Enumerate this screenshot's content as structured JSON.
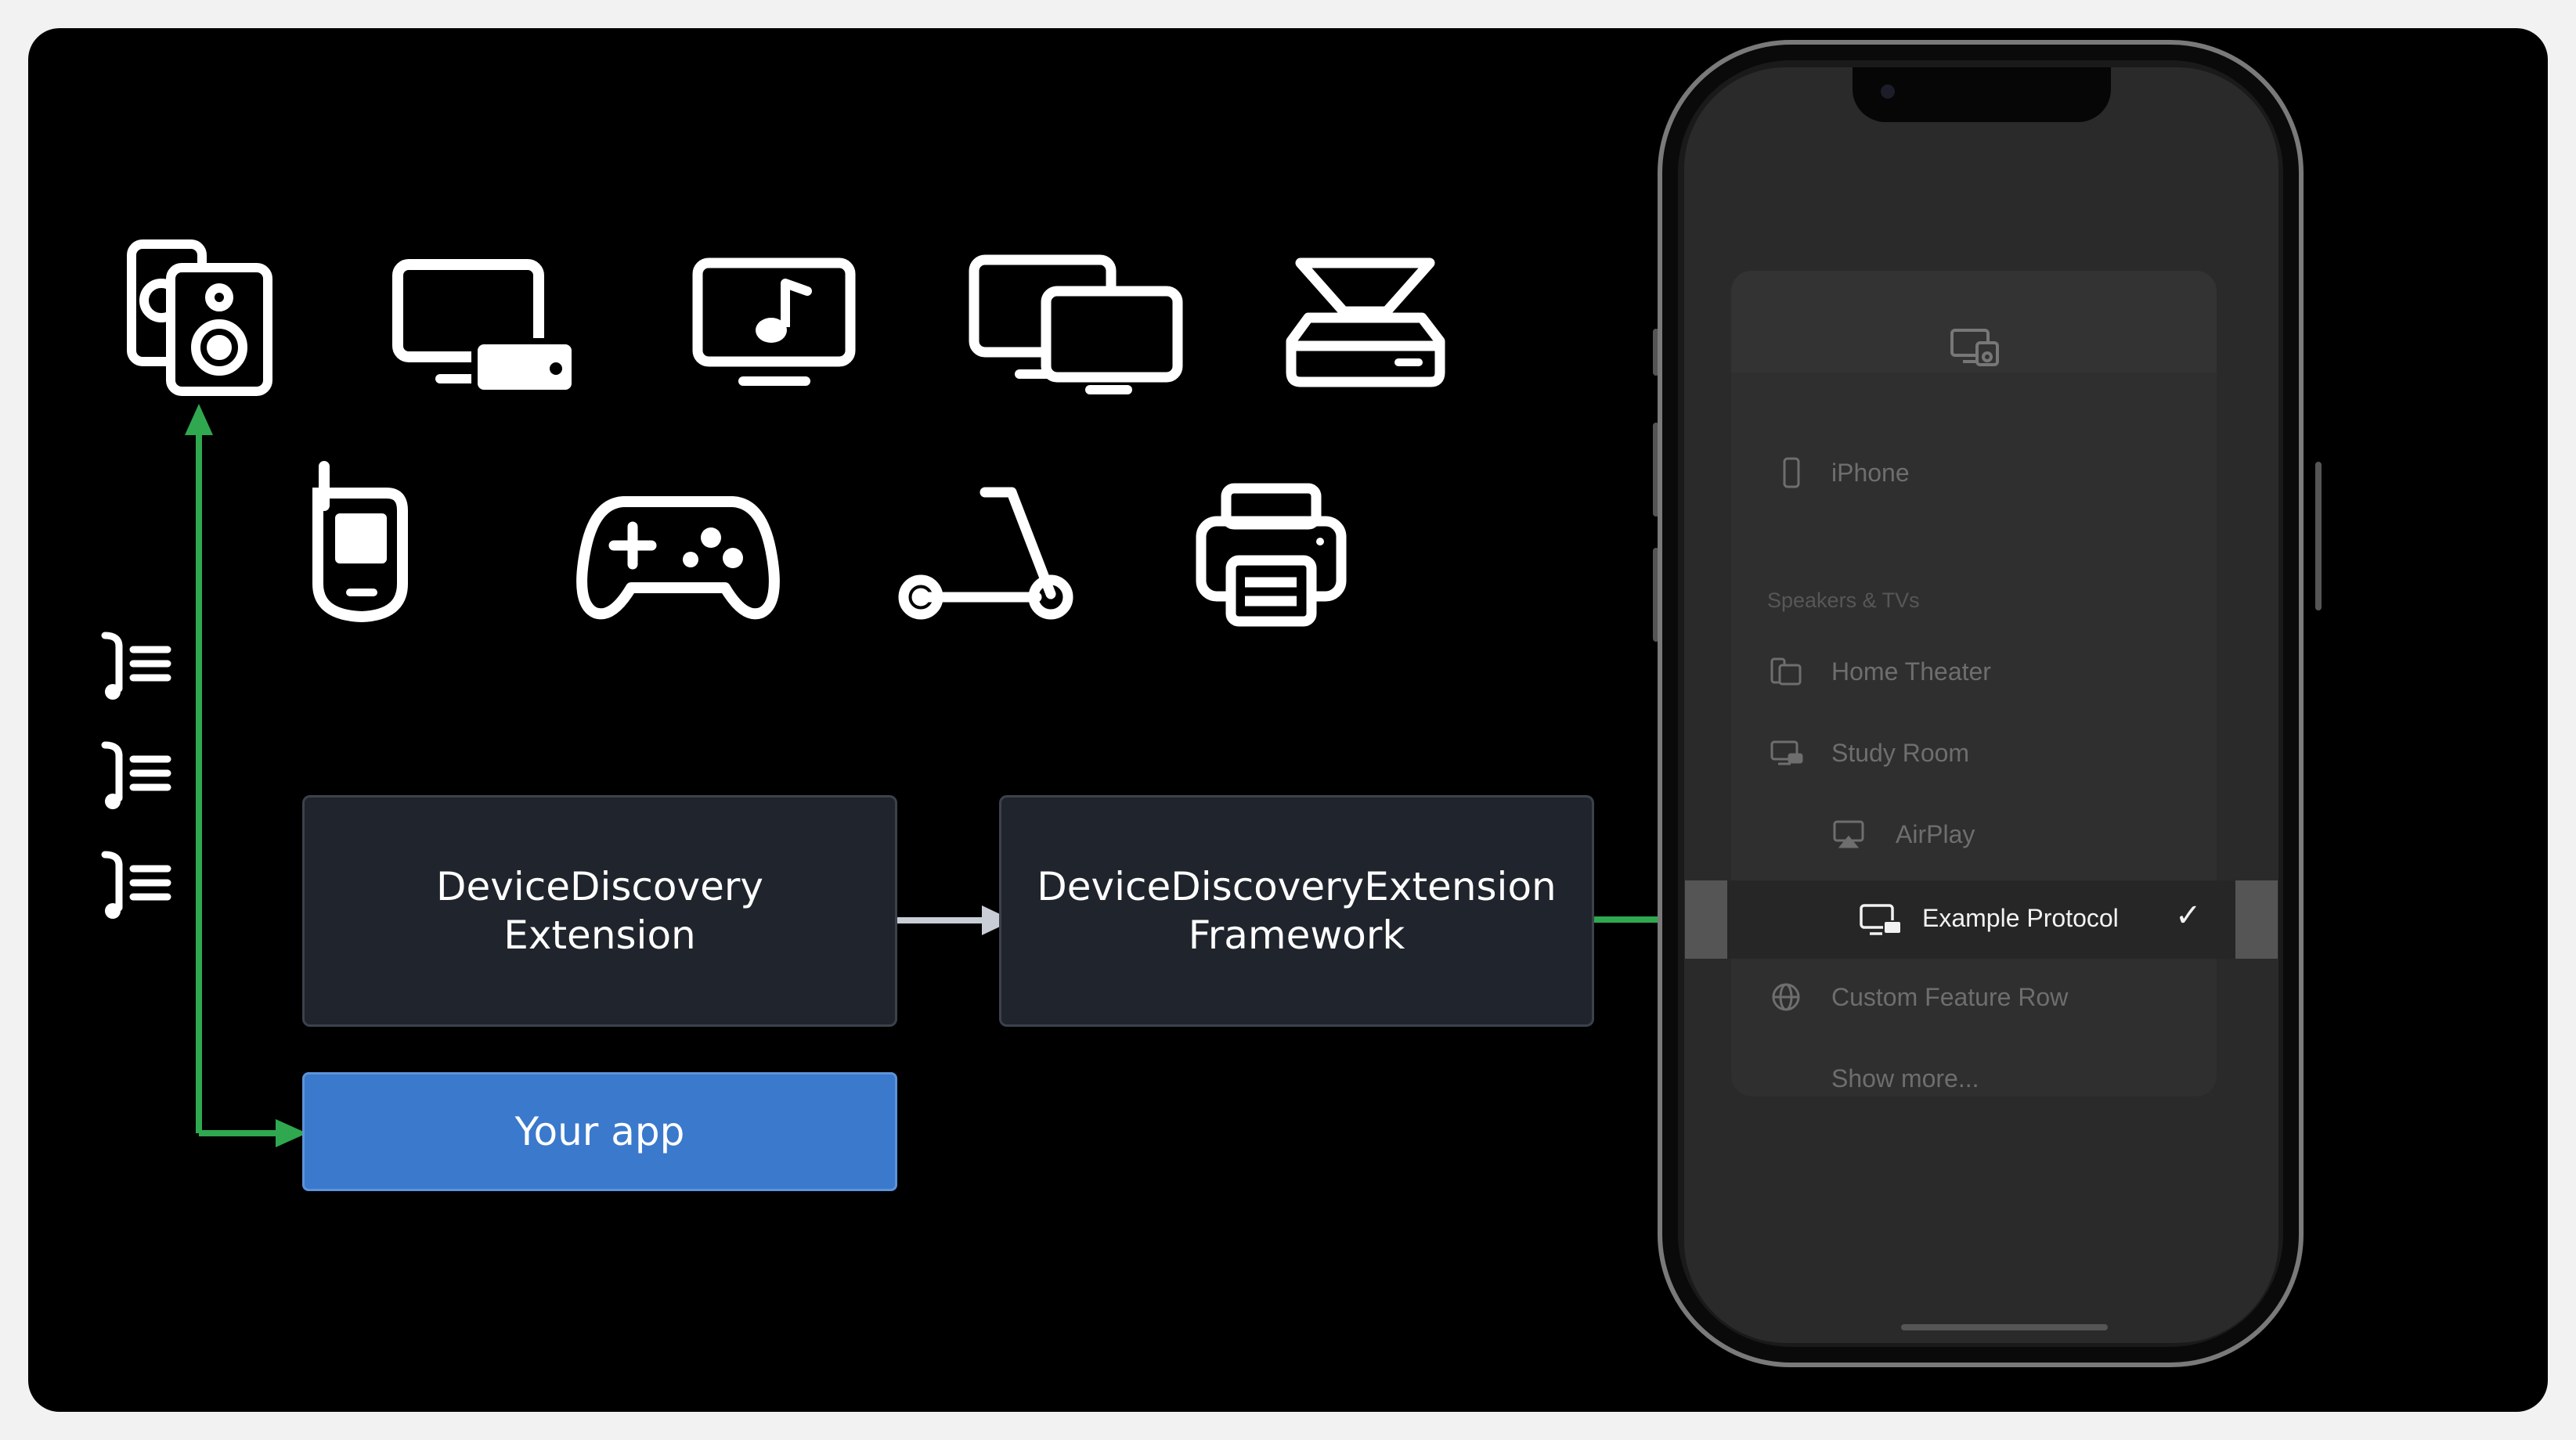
{
  "diagram": {
    "extension_box": {
      "line1": "DeviceDiscovery",
      "line2": "Extension"
    },
    "framework_box": {
      "line1": "DeviceDiscoveryExtension",
      "line2": "Framework"
    },
    "app_box": {
      "label": "Your app"
    },
    "device_icons": [
      "speakers-icon",
      "tv-with-box-icon",
      "music-display-icon",
      "multiple-displays-icon",
      "scanner-icon",
      "walkie-talkie-icon",
      "game-controller-icon",
      "scooter-icon",
      "printer-icon"
    ],
    "protocol_icons": [
      "protocol-list-icon",
      "protocol-list-icon",
      "protocol-list-icon"
    ],
    "colors": {
      "arrow_green": "#2fa84f",
      "app_blue": "#3a79cc",
      "box_bg": "#20242c"
    }
  },
  "phone_menu": {
    "header_icon": "screens-icon",
    "rows": [
      {
        "label": "iPhone",
        "icon": "iphone-icon"
      },
      {
        "label": "Home Theater",
        "icon": "apple-tv-icon"
      },
      {
        "label": "Study Room",
        "icon": "display-icon"
      },
      {
        "label": "AirPlay",
        "icon": "airplay-icon"
      },
      {
        "label": "Custom Feature Row",
        "icon": "globe-icon"
      },
      {
        "label": "Show more..."
      }
    ],
    "section": "Speakers & TVs",
    "selected": {
      "label": "Example Protocol",
      "icon": "display-box-icon",
      "checkmark": "✓"
    }
  }
}
